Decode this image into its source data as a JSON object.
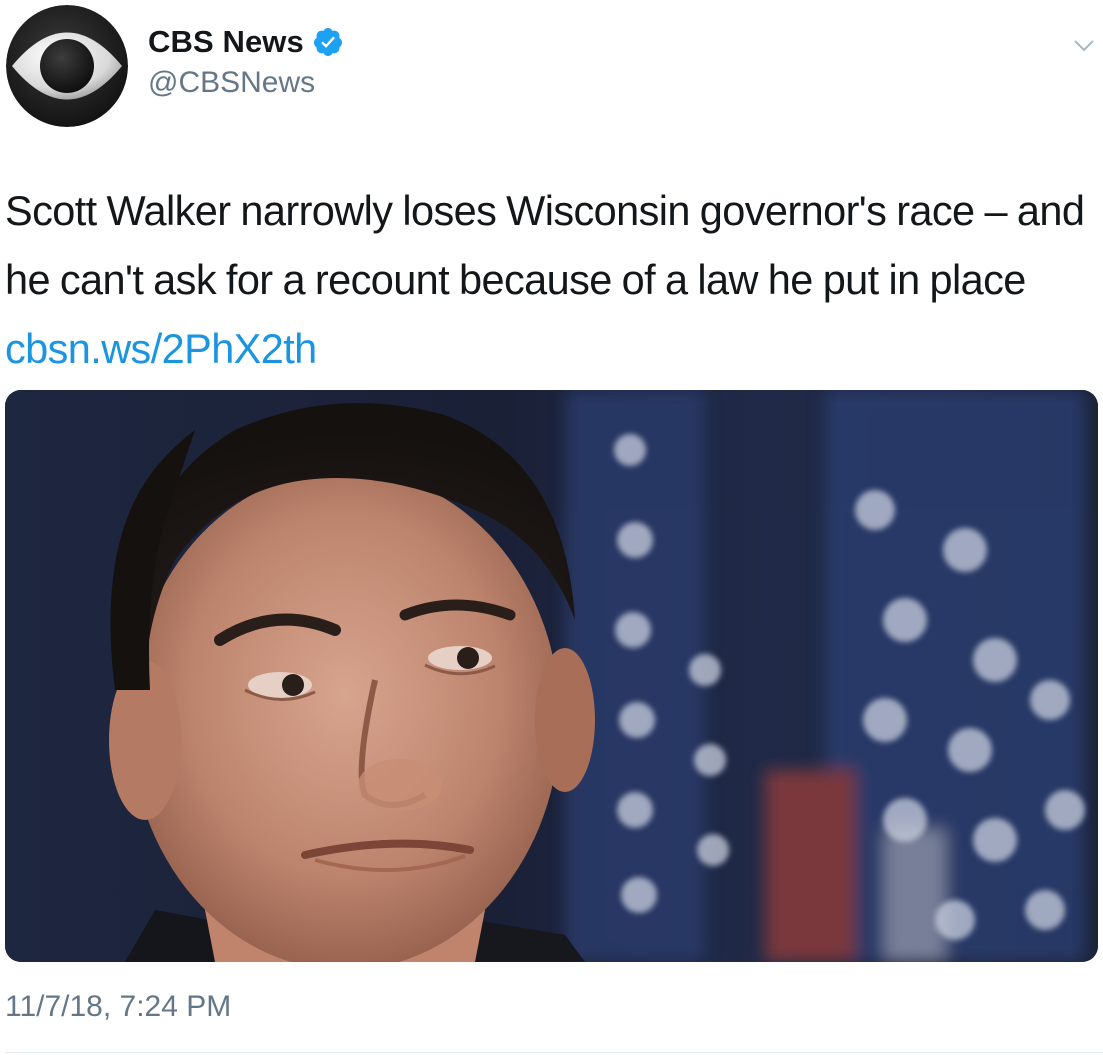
{
  "account": {
    "display_name": "CBS News",
    "handle": "@CBSNews",
    "verified": true,
    "avatar_icon": "cbs-eye-logo",
    "verified_icon": "verified-badge-icon",
    "menu_icon": "chevron-down-icon"
  },
  "tweet": {
    "text": "Scott Walker narrowly loses Wisconsin governor's race – and he can't ask for a recount because of a law he put in place ",
    "link": "cbsn.ws/2PhX2th",
    "timestamp": "11/7/18, 7:24 PM"
  },
  "colors": {
    "link": "#1b95e0",
    "secondary_text": "#657786",
    "verified_badge": "#1da1f2",
    "primary_text": "#14171a"
  }
}
